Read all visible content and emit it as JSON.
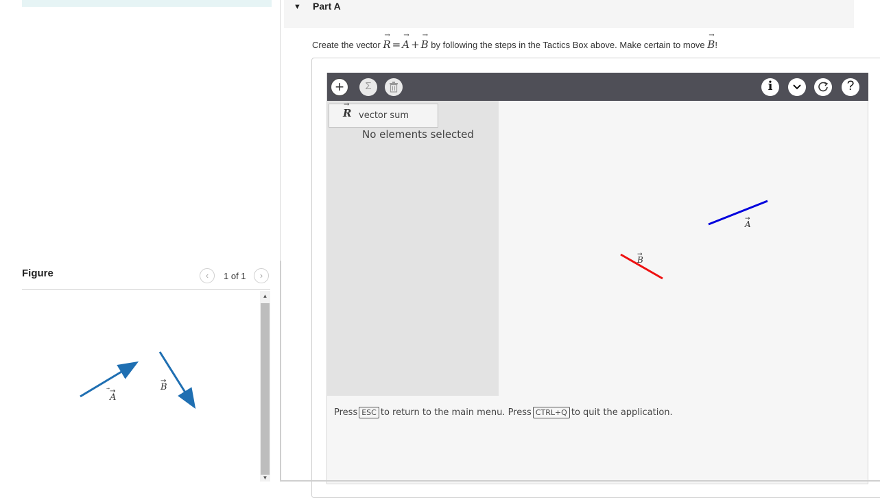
{
  "left_panel": {
    "figure_title": "Figure",
    "pagination": {
      "prev_icon": "‹",
      "text": "1 of 1",
      "next_icon": "›"
    },
    "figure_vectors": {
      "a_label": "A",
      "b_label": "B",
      "color": "#1f6fb2"
    }
  },
  "part": {
    "caret_icon": "caret-down-icon",
    "title": "Part A",
    "instruction": {
      "prefix": "Create the vector",
      "r": "R",
      "eq": "=",
      "a": "A",
      "plus": "+",
      "b": "B",
      "middle": "by following the steps in the Tactics Box above. Make certain to move",
      "b2": "B",
      "suffix": "!"
    }
  },
  "app": {
    "toolbar": {
      "add_icon": "+",
      "sum_icon": "Σ",
      "trash_icon": "🗑",
      "info_icon": "i",
      "dropdown_icon": "⌄",
      "reset_icon": "↻",
      "help_icon": "?"
    },
    "dropdown_item": {
      "symbol": "R",
      "label": "vector sum"
    },
    "selection_status": "No elements selected",
    "canvas_vectors": [
      {
        "label": "A",
        "color": "#0000dd"
      },
      {
        "label": "B",
        "color": "#ee1111"
      }
    ],
    "hint": {
      "part1": "Press",
      "key1": "ESC",
      "part2": "to return to the main menu. Press",
      "key2": "CTRL+Q",
      "part3": "to quit the application."
    }
  }
}
